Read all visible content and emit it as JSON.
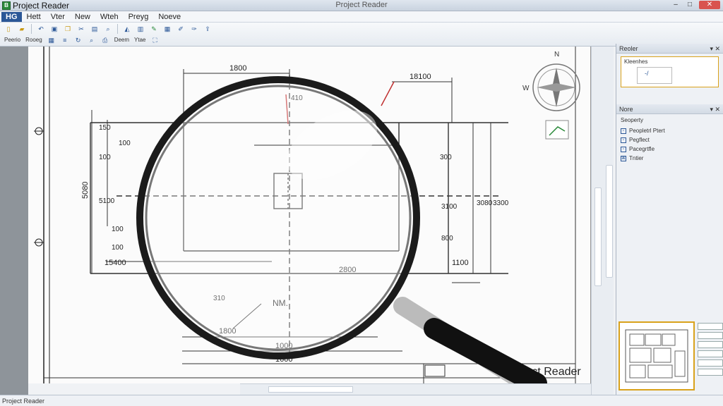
{
  "window": {
    "title": "Project Reader",
    "center_title": "Project Reader",
    "app_icon": "B",
    "controls": [
      "–",
      "□",
      "✕"
    ]
  },
  "menu": {
    "file": "HG",
    "items": [
      "Hett",
      "Vter",
      "New",
      "Wteh",
      "Preyg",
      "Noeve"
    ]
  },
  "toolbar": {
    "labels": [
      "Peerio",
      "Rooeg",
      "Deem",
      "Ytae"
    ]
  },
  "right_panel": {
    "pane1_title": "Reoler",
    "properties_label": "Kleenhes",
    "properties_value": "-/",
    "pane2_title": "Nore",
    "nav_header": "Seoperty",
    "nav_items": [
      "Peopletrl Ptert",
      "Pegflect",
      "Pacegrtfle",
      "Tntier"
    ]
  },
  "drawing": {
    "compass_n": "N",
    "compass_w": "W",
    "dims": {
      "top1": "1800",
      "top2": "18100",
      "left_outer": "5080",
      "left_mid1": "100",
      "left_mid2": "5100",
      "left_small1": "150",
      "left_small2": "100",
      "left_small3": "100",
      "left_small4": "100",
      "bottom_left": "15400",
      "mid_bottom": "2800",
      "diag_label": "NM.",
      "bottom1": "1800",
      "bottom2": "1000",
      "bottom3": "1600",
      "right1": "300",
      "right2": "3080",
      "right3": "3300",
      "right4": "3100",
      "right5": "800",
      "right_bottom": "1100",
      "vert_mid": "410",
      "vert_low": "310"
    },
    "title_block": "Project Reader"
  },
  "status": {
    "text": "Project Reader"
  }
}
